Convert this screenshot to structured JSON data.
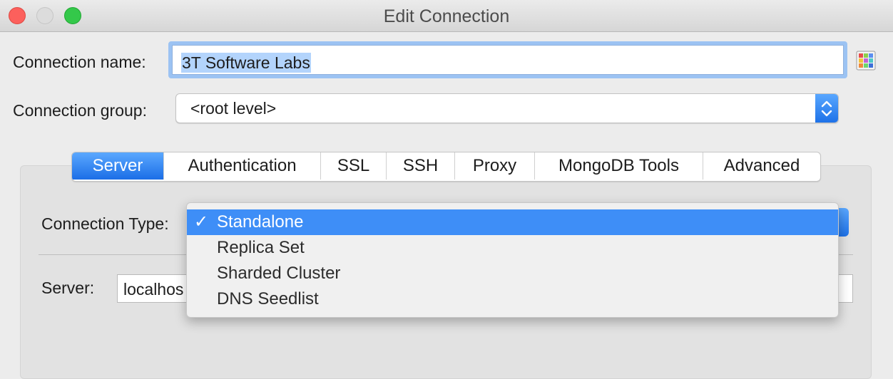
{
  "window": {
    "title": "Edit Connection"
  },
  "form": {
    "connection_name_label": "Connection name:",
    "connection_name_value": "3T Software Labs",
    "connection_group_label": "Connection group:",
    "connection_group_value": "<root level>"
  },
  "tabs": [
    {
      "label": "Server",
      "active": true
    },
    {
      "label": "Authentication"
    },
    {
      "label": "SSL"
    },
    {
      "label": "SSH"
    },
    {
      "label": "Proxy"
    },
    {
      "label": "MongoDB Tools"
    },
    {
      "label": "Advanced"
    }
  ],
  "server_tab": {
    "connection_type_label": "Connection Type:",
    "server_label": "Server:",
    "server_value": "localhos"
  },
  "connection_type_menu": {
    "check_glyph": "✓",
    "options": [
      "Standalone",
      "Replica Set",
      "Sharded Cluster",
      "DNS Seedlist"
    ],
    "selected": "Standalone"
  },
  "colors": {
    "accent": "#3e8ef7",
    "selection": "#b3d4fc",
    "focus_ring": "#9cc3f3"
  },
  "icons": {
    "connection_color": "color-grid-icon",
    "stepper": "chevron-up-down-icon"
  }
}
